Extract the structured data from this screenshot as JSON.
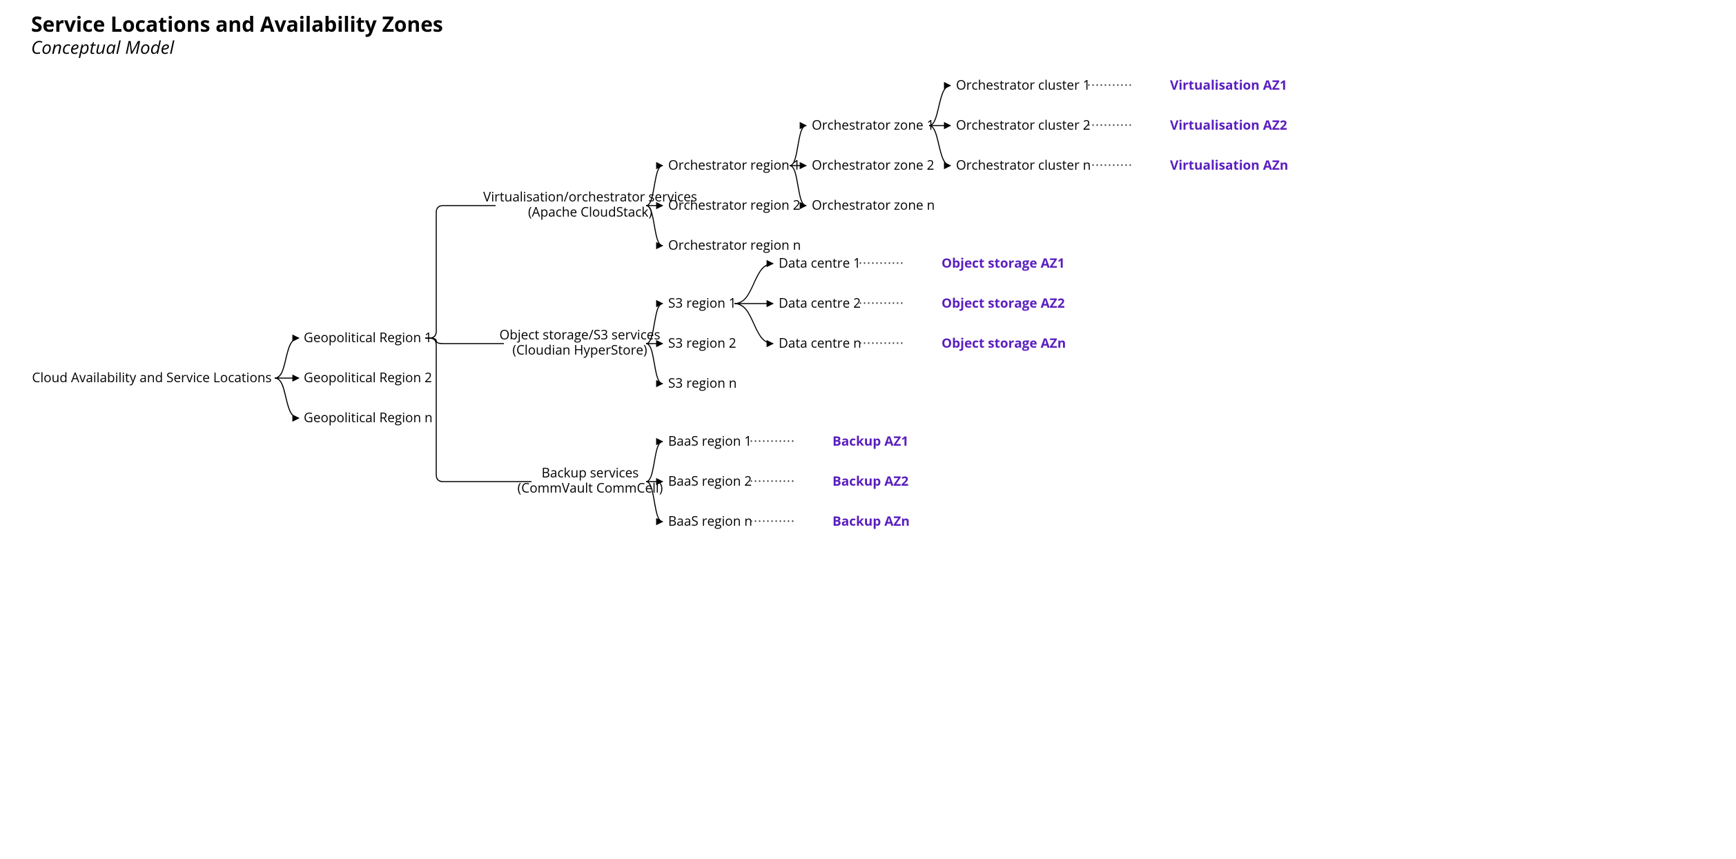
{
  "title": "Service Locations and Availability Zones",
  "subtitle": "Conceptual Model",
  "root": "Cloud Availability and Service Locations",
  "geo": {
    "r1": "Geopolitical Region 1",
    "r2": "Geopolitical Region 2",
    "rn": "Geopolitical Region n"
  },
  "svc": {
    "virt_l1": "Virtualisation/orchestrator services",
    "virt_l2": "(Apache CloudStack)",
    "obj_l1": "Object storage/S3 services",
    "obj_l2": "(Cloudian HyperStore)",
    "baas_l1": "Backup services",
    "baas_l2": "(CommVault CommCell)"
  },
  "orch_region": {
    "r1": "Orchestrator region 1",
    "r2": "Orchestrator region 2",
    "rn": "Orchestrator region n"
  },
  "orch_zone": {
    "z1": "Orchestrator zone 1",
    "z2": "Orchestrator zone 2",
    "zn": "Orchestrator zone n"
  },
  "orch_cluster": {
    "c1": "Orchestrator cluster 1",
    "c2": "Orchestrator cluster 2",
    "cn": "Orchestrator cluster n"
  },
  "virt_az": {
    "a1": "Virtualisation AZ1",
    "a2": "Virtualisation AZ2",
    "an": "Virtualisation AZn"
  },
  "s3_region": {
    "r1": "S3 region 1",
    "r2": "S3 region 2",
    "rn": "S3 region n"
  },
  "dc": {
    "d1": "Data centre 1",
    "d2": "Data centre 2",
    "dn": "Data centre n"
  },
  "obj_az": {
    "a1": "Object storage AZ1",
    "a2": "Object storage AZ2",
    "an": "Object storage AZn"
  },
  "baas_region": {
    "r1": "BaaS region 1",
    "r2": "BaaS region 2",
    "rn": "BaaS region n"
  },
  "baas_az": {
    "a1": "Backup AZ1",
    "a2": "Backup AZ2",
    "an": "Backup AZn"
  },
  "dots": "···········"
}
